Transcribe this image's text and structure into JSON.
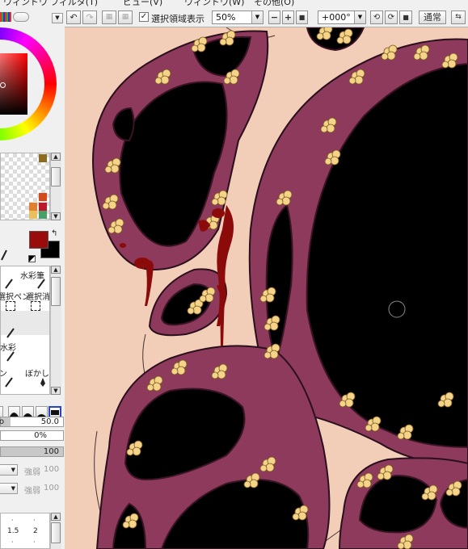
{
  "menubar": {
    "items": [
      "ウィンドウ",
      "フィルタ(T)",
      "ビュー(V)",
      "ウィンドウ(W)",
      "その他(O)"
    ]
  },
  "toolbar": {
    "show_selection_label": "選択領域表示",
    "zoom_value": "50%",
    "rotation_value": "+000°",
    "blend_mode": "通常"
  },
  "color_panel": {
    "main_color": "#9a0c0c",
    "sub_color": "#000000",
    "swatches": [
      "#8c6b1f",
      "#d44a1a",
      "#e08030",
      "#c0182a",
      "#e8c060",
      "#48a068",
      "#7a1010",
      "#d23838"
    ]
  },
  "tools": {
    "items": [
      "水彩筆",
      "選択ペン",
      "選択消し",
      "水彩",
      "ペン",
      "ぼかし"
    ]
  },
  "brush": {
    "size_value": "50.0",
    "min_size_value": "0%",
    "density_value": "100",
    "strength_label_1": "強弱",
    "strength_value_1": "100",
    "strength_label_2": "強弱",
    "strength_value_2": "100",
    "size_label_a": "1.5",
    "size_label_b": "2"
  },
  "canvas": {
    "background_color": "#f2cdb8",
    "flesh_color": "#8d3a5c",
    "hole_color": "#000000",
    "nodule_color": "#f5d48a",
    "blood_color": "#8b0a0a"
  }
}
